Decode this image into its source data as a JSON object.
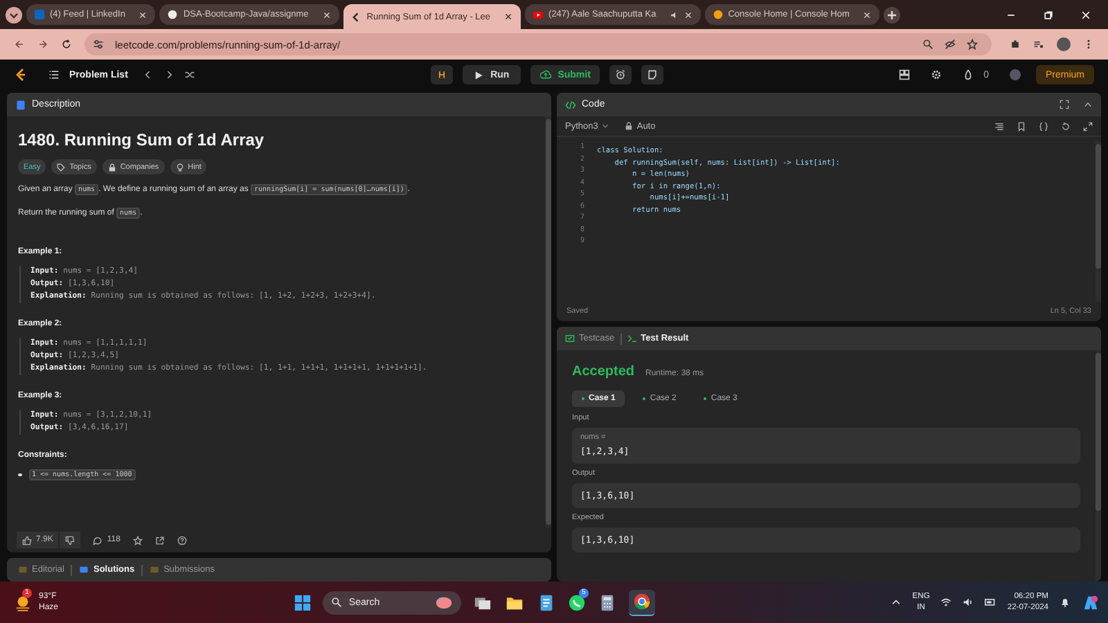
{
  "browser_tabs": [
    {
      "title": "(4) Feed | LinkedIn",
      "kind": "linkedin",
      "selected": false,
      "audio": false
    },
    {
      "title": "DSA-Bootcamp-Java/assignme",
      "kind": "github",
      "selected": false,
      "audio": false
    },
    {
      "title": "Running Sum of 1d Array - Lee",
      "kind": "leetcode",
      "selected": true,
      "audio": false
    },
    {
      "title": "(247) Aale Saachuputta Ka",
      "kind": "youtube",
      "selected": false,
      "audio": true
    },
    {
      "title": "Console Home | Console Hom",
      "kind": "console",
      "selected": false,
      "audio": false
    }
  ],
  "address_bar": {
    "url": "leetcode.com/problems/running-sum-of-1d-array/"
  },
  "nav": {
    "problem_list": "Problem List",
    "run": "Run",
    "submit": "Submit",
    "streak": "0",
    "premium": "Premium"
  },
  "description": {
    "header": "Description",
    "title": "1480. Running Sum of 1d Array",
    "tags": [
      {
        "label": "Easy",
        "kind": "difficulty"
      },
      {
        "label": "Topics",
        "kind": "topics"
      },
      {
        "label": "Companies",
        "kind": "companies"
      },
      {
        "label": "Hint",
        "kind": "hint"
      }
    ],
    "paragraphs": [
      [
        {
          "text": "Given an array ",
          "code": false
        },
        {
          "text": "nums",
          "code": true
        },
        {
          "text": ". We define a running sum of an array as ",
          "code": false
        },
        {
          "text": "runningSum[i] = sum(nums[0]…nums[i])",
          "code": true
        },
        {
          "text": ".",
          "code": false
        }
      ],
      [
        {
          "text": "Return the running sum of ",
          "code": false
        },
        {
          "text": "nums",
          "code": true
        },
        {
          "text": ".",
          "code": false
        }
      ]
    ],
    "examples": [
      {
        "title": "Example 1:",
        "lines": [
          "**Input:** nums = [1,2,3,4]",
          "**Output:** [1,3,6,10]",
          "**Explanation:** Running sum is obtained as follows: [1, 1+2, 1+2+3, 1+2+3+4]."
        ]
      },
      {
        "title": "Example 2:",
        "lines": [
          "**Input:** nums = [1,1,1,1,1]",
          "**Output:** [1,2,3,4,5]",
          "**Explanation:** Running sum is obtained as follows: [1, 1+1, 1+1+1, 1+1+1+1, 1+1+1+1+1]."
        ]
      },
      {
        "title": "Example 3:",
        "lines": [
          "**Input:** nums = [3,1,2,10,1]",
          "**Output:** [3,4,6,16,17]"
        ]
      }
    ],
    "constraints_title": "Constraints:",
    "constraints": [
      "1 <= nums.length <= 1000"
    ],
    "likes": "7.9K",
    "comments": "118"
  },
  "bottom_tabs": [
    {
      "label": "Editorial",
      "selected": false
    },
    {
      "label": "Solutions",
      "selected": true
    },
    {
      "label": "Submissions",
      "selected": false
    }
  ],
  "code": {
    "header": "Code",
    "language": "Python3",
    "mode": "Auto",
    "lines": [
      {
        "number": "1",
        "text": "class Solution:"
      },
      {
        "number": "2",
        "text": "    def runningSum(self, nums: List[int]) -> List[int]:"
      },
      {
        "number": "3",
        "text": "        n = len(nums)"
      },
      {
        "number": "4",
        "text": "        for i in range(1,n):"
      },
      {
        "number": "5",
        "text": "            nums[i]+=nums[i-1]"
      },
      {
        "number": "6",
        "text": "        return nums"
      },
      {
        "number": "7"
      },
      {
        "number": "8"
      },
      {
        "number": "9"
      }
    ],
    "status": "Saved",
    "cursor": "Ln 5, Col 33"
  },
  "result_tabs": [
    {
      "label": "Testcase",
      "selected": false
    },
    {
      "label": "Test Result",
      "selected": true
    }
  ],
  "result": {
    "verdict": "Accepted",
    "runtime": "Runtime: 38 ms",
    "cases": [
      {
        "label": "Case 1",
        "selected": true
      },
      {
        "label": "Case 2",
        "selected": false
      },
      {
        "label": "Case 3",
        "selected": false
      }
    ],
    "input_label": "Input",
    "input_name": "nums =",
    "input_value": "[1,2,3,4]",
    "output_label": "Output",
    "output_value": "[1,3,6,10]",
    "expected_label": "Expected",
    "expected_value": "[1,3,6,10]"
  },
  "taskbar": {
    "temperature": "93°F",
    "weather": "Haze",
    "weather_badge": "1",
    "search": "Search",
    "whatsapp_badge": "5",
    "lang": "ENG",
    "region": "IN",
    "time": "06:20 PM",
    "date": "22-07-2024"
  }
}
